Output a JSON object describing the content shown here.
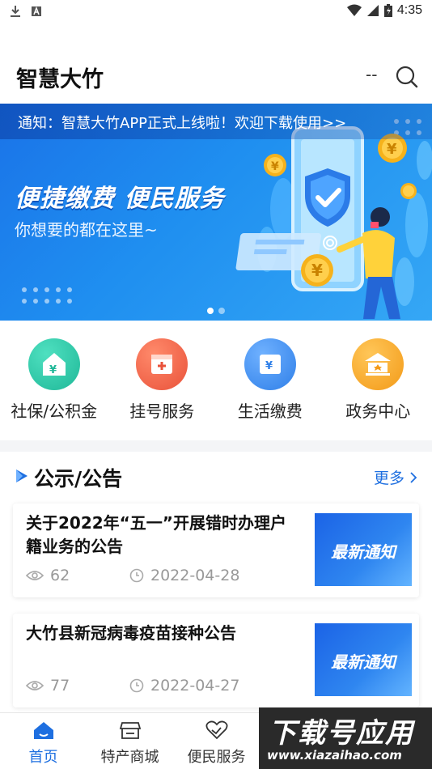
{
  "status_bar": {
    "time": "4:35"
  },
  "header": {
    "title": "智慧大竹",
    "dash": "--"
  },
  "banner": {
    "notice": "通知：智慧大竹APP正式上线啦！欢迎下载使用>>",
    "headline": "便捷缴费  便民服务",
    "subline": "你想要的都在这里~",
    "coin_symbol": "¥"
  },
  "services": [
    {
      "label": "社保/公积金",
      "icon": "house-yuan-icon",
      "color": "#25c4a3"
    },
    {
      "label": "挂号服务",
      "icon": "calendar-plus-icon",
      "color": "#f0674a"
    },
    {
      "label": "生活缴费",
      "icon": "wallet-yuan-icon",
      "color": "#3e8ef2"
    },
    {
      "label": "政务中心",
      "icon": "government-building-icon",
      "color": "#f7a928"
    }
  ],
  "announcements": {
    "title": "公示/公告",
    "more": "更多",
    "items": [
      {
        "title": "关于2022年“五一”开展错时办理户籍业务的公告",
        "views": "62",
        "date": "2022-04-28",
        "thumb_text": "最新通知"
      },
      {
        "title": "大竹县新冠病毒疫苗接种公告",
        "views": "77",
        "date": "2022-04-27",
        "thumb_text": "最新通知"
      }
    ]
  },
  "bottom_nav": [
    {
      "label": "首页",
      "icon": "home-icon",
      "active": true
    },
    {
      "label": "特产商城",
      "icon": "store-icon",
      "active": false
    },
    {
      "label": "便民服务",
      "icon": "heart-hand-icon",
      "active": false
    }
  ],
  "watermark": {
    "line1": "下载号应用",
    "line2": "www.xiazaihao.com"
  },
  "colors": {
    "accent": "#1e6fe0"
  }
}
